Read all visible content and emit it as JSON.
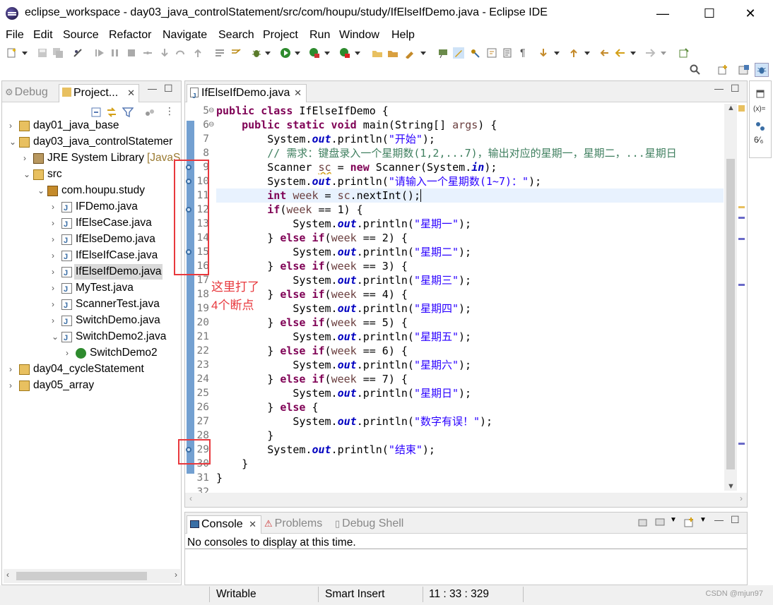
{
  "window": {
    "title": "eclipse_workspace - day03_java_controlStatement/src/com/houpu/study/IfElseIfDemo.java - Eclipse IDE",
    "minimize": "—",
    "maximize": "☐",
    "close": "✕"
  },
  "menu": [
    "File",
    "Edit",
    "Source",
    "Refactor",
    "Navigate",
    "Search",
    "Project",
    "Run",
    "Window",
    "Help"
  ],
  "left_panel": {
    "tabs": [
      "Debug",
      "Project..."
    ],
    "tree": [
      {
        "label": "day01_java_base",
        "level": 0,
        "expanded": false,
        "icon": "project-icon"
      },
      {
        "label": "day03_java_controlStatemer",
        "level": 0,
        "expanded": true,
        "icon": "project-icon"
      },
      {
        "label": "JRE System Library",
        "extra": "[JavaS",
        "level": 1,
        "expanded": false,
        "icon": "library-icon"
      },
      {
        "label": "src",
        "level": 1,
        "expanded": true,
        "icon": "source-folder-icon"
      },
      {
        "label": "com.houpu.study",
        "level": 2,
        "expanded": true,
        "icon": "package-icon"
      },
      {
        "label": "IFDemo.java",
        "level": 3,
        "expanded": false,
        "icon": "java-file-icon"
      },
      {
        "label": "IfElseCase.java",
        "level": 3,
        "expanded": false,
        "icon": "java-file-icon"
      },
      {
        "label": "IfElseDemo.java",
        "level": 3,
        "expanded": false,
        "icon": "java-file-icon"
      },
      {
        "label": "IfElseIfCase.java",
        "level": 3,
        "expanded": false,
        "icon": "java-file-icon"
      },
      {
        "label": "IfElseIfDemo.java",
        "level": 3,
        "expanded": false,
        "icon": "java-file-icon",
        "selected": true
      },
      {
        "label": "MyTest.java",
        "level": 3,
        "expanded": false,
        "icon": "java-file-icon"
      },
      {
        "label": "ScannerTest.java",
        "level": 3,
        "expanded": false,
        "icon": "java-file-icon"
      },
      {
        "label": "SwitchDemo.java",
        "level": 3,
        "expanded": false,
        "icon": "java-file-icon"
      },
      {
        "label": "SwitchDemo2.java",
        "level": 3,
        "expanded": true,
        "icon": "java-file-icon"
      },
      {
        "label": "SwitchDemo2",
        "level": 4,
        "expanded": false,
        "icon": "class-icon"
      },
      {
        "label": "day04_cycleStatement",
        "level": 0,
        "expanded": false,
        "icon": "project-icon"
      },
      {
        "label": "day05_array",
        "level": 0,
        "expanded": false,
        "icon": "project-icon"
      }
    ]
  },
  "editor": {
    "tab": "IfElseIfDemo.java",
    "line_numbers": [
      "5",
      "6",
      "7",
      "8",
      "9",
      "10",
      "11",
      "12",
      "13",
      "14",
      "15",
      "16",
      "17",
      "18",
      "19",
      "20",
      "21",
      "22",
      "23",
      "24",
      "25",
      "26",
      "27",
      "28",
      "29",
      "30",
      "31",
      "32"
    ],
    "current_line_index": 6,
    "breakpoint_lines": [
      "9",
      "10",
      "12",
      "15",
      "29"
    ]
  },
  "console": {
    "tabs": [
      "Console",
      "Problems",
      "Debug Shell"
    ],
    "message": "No consoles to display at this time."
  },
  "status": {
    "mode": "Writable",
    "insert": "Smart Insert",
    "position": "11 : 33 : 329"
  },
  "annotation": {
    "line1": "这里打了",
    "line2": "4个断点"
  },
  "watermark": "CSDN @mjun97",
  "colors": {
    "keyword": "#7f0055",
    "string": "#2a00ff",
    "comment": "#3f7f5f",
    "static_field": "#0000c0",
    "annotation_red": "#e8383d"
  }
}
